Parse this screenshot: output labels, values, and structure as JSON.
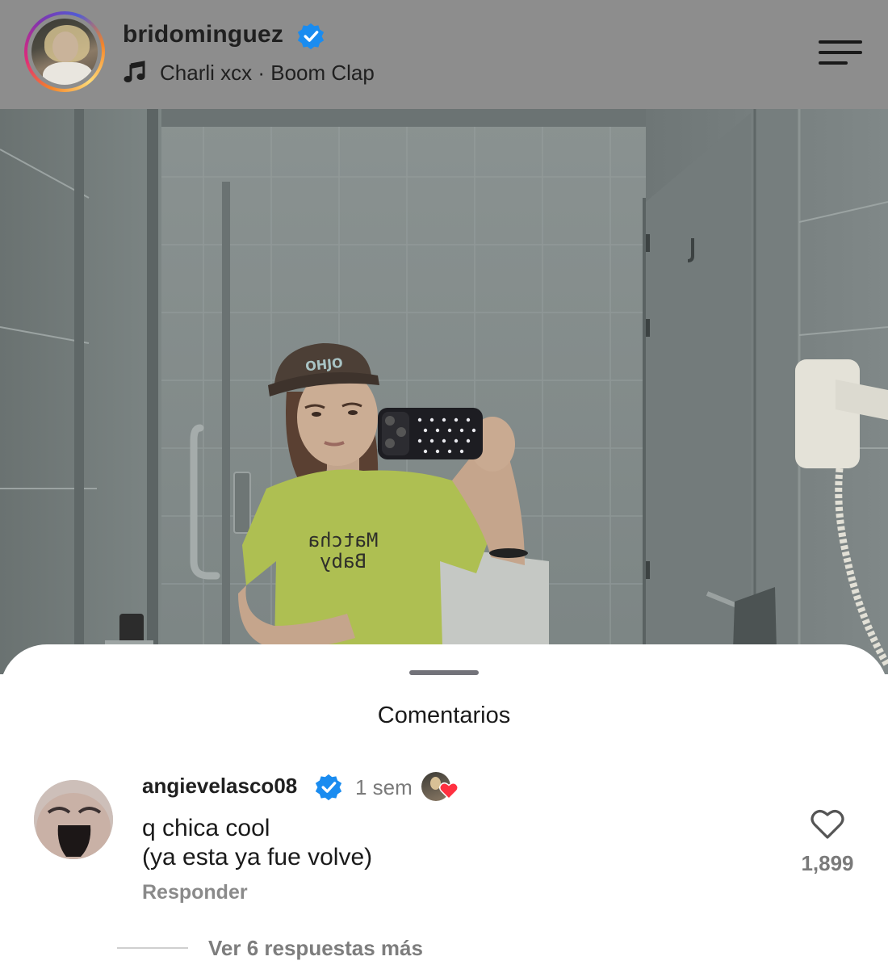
{
  "post_header": {
    "username": "bridominguez",
    "verified": true,
    "music": "Charli xcx · Boom Clap",
    "icons": {
      "music": "music-note-icon",
      "menu": "menu-icon",
      "verified": "verified-badge-icon"
    }
  },
  "photo": {
    "description_alt": "",
    "shirt_text_line1": "Matcha",
    "shirt_text_line2": "Baby",
    "cap_text": "OHJO"
  },
  "comments_sheet": {
    "title": "Comentarios",
    "comments": [
      {
        "username": "angievelasco08",
        "verified": true,
        "time": "1 sem",
        "liked_by_author": true,
        "text_line1": "q chica cool",
        "text_line2": "(ya esta ya fue volve)",
        "reply_label": "Responder",
        "like_count": "1,899",
        "view_replies_label": "Ver 6 respuestas más"
      }
    ]
  },
  "colors": {
    "verified_blue": "#1a8cf0",
    "heart_red": "#ff3040",
    "header_bg": "#8d8d8d"
  }
}
